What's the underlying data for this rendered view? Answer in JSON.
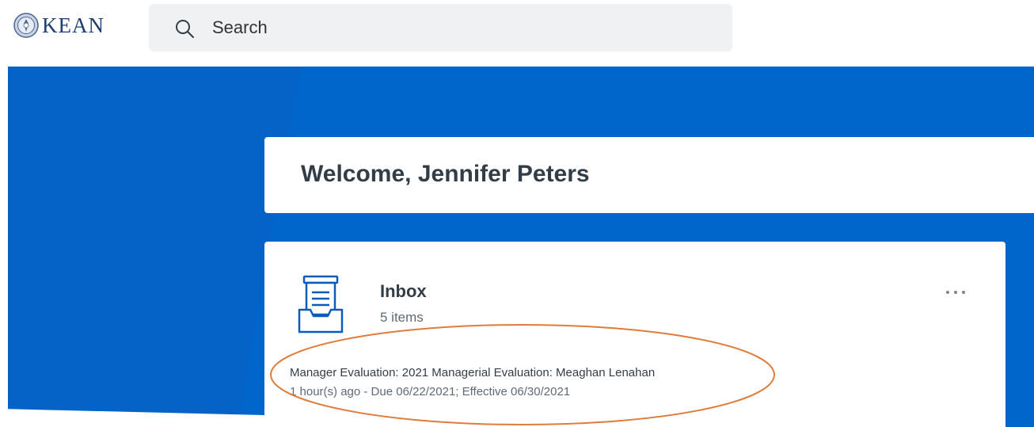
{
  "header": {
    "logo_text": "KEAN",
    "search": {
      "placeholder": "Search",
      "value": ""
    }
  },
  "welcome": {
    "title": "Welcome, Jennifer Peters"
  },
  "inbox": {
    "title": "Inbox",
    "count": "5 items",
    "latest_task": {
      "title": "Manager Evaluation: 2021 Managerial Evaluation: Meaghan Lenahan",
      "meta": "1 hour(s) ago - Due 06/22/2021; Effective 06/30/2021"
    }
  },
  "colors": {
    "banner_blue": "#0066cc",
    "banner_blue_dark": "#0a5fc2",
    "annotation_orange": "#e07b39",
    "icon_blue": "#0b5cb8"
  },
  "icons": [
    "kean-seal-icon",
    "search-icon",
    "inbox-tray-icon",
    "more-options-icon"
  ]
}
